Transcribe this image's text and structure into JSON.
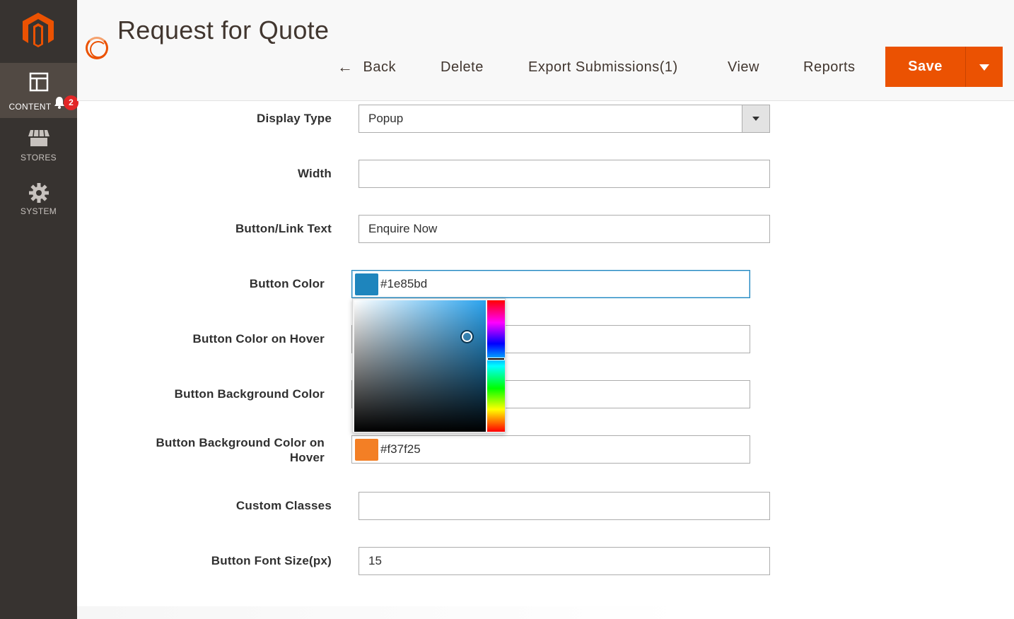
{
  "sidebar": {
    "items": [
      {
        "label": "CONTENT",
        "icon": "layout-icon",
        "active": true
      },
      {
        "label": "STORES",
        "icon": "store-icon",
        "active": false
      },
      {
        "label": "SYSTEM",
        "icon": "gear-icon",
        "active": false
      }
    ],
    "notification_count": "2"
  },
  "header": {
    "title": "Request for Quote",
    "toolbar": {
      "back_label": "Back",
      "delete_label": "Delete",
      "export_label": "Export Submissions(1)",
      "view_label": "View",
      "reports_label": "Reports",
      "save_label": "Save"
    }
  },
  "form": {
    "display_type": {
      "label": "Display Type",
      "value": "Popup"
    },
    "width": {
      "label": "Width",
      "value": ""
    },
    "button_text": {
      "label": "Button/Link Text",
      "value": "Enquire Now"
    },
    "button_color": {
      "label": "Button Color",
      "value": "#1e85bd",
      "swatch": "#1e85bd"
    },
    "button_color_hover": {
      "label": "Button Color on Hover",
      "value": ""
    },
    "button_bg_color": {
      "label": "Button Background Color",
      "value": ""
    },
    "button_bg_color_hover": {
      "label_line1": "Button Background Color on",
      "label_line2": "Hover",
      "value": "#f37f25",
      "swatch": "#f37f25"
    },
    "custom_classes": {
      "label": "Custom Classes",
      "value": ""
    },
    "font_size": {
      "label": "Button Font Size(px)",
      "value": "15"
    }
  },
  "colors": {
    "accent": "#eb5202",
    "sidebar_bg": "#373330",
    "focus": "#1e85bd"
  }
}
